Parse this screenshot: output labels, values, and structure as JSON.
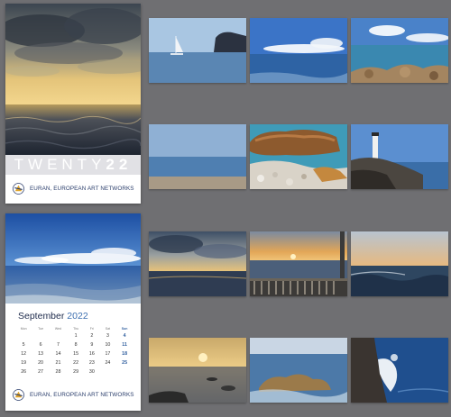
{
  "cover": {
    "title_light": "TWENTY",
    "title_bold": "22",
    "brand_name": "EURAN, EUROPEAN ART NETWORKS"
  },
  "month_page": {
    "month": "September",
    "year": "2022",
    "brand_name": "EURAN, EUROPEAN ART NETWORKS",
    "weekday_headers": [
      "Mon",
      "Tue",
      "Wed",
      "Thu",
      "Fri",
      "Sat",
      "Sun"
    ],
    "weeks": [
      [
        "",
        "",
        "",
        "1",
        "2",
        "3",
        "4"
      ],
      [
        "5",
        "6",
        "7",
        "8",
        "9",
        "10",
        "11"
      ],
      [
        "12",
        "13",
        "14",
        "15",
        "16",
        "17",
        "18"
      ],
      [
        "19",
        "20",
        "21",
        "22",
        "23",
        "24",
        "25"
      ],
      [
        "26",
        "27",
        "28",
        "29",
        "30",
        "",
        ""
      ]
    ]
  },
  "thumbnails": [
    "sailboat-and-cliff",
    "blue-sea-horizon",
    "rocky-shore-clouds",
    "calm-blue-horizon",
    "beach-boulders-pebbles",
    "lighthouse-on-rocks",
    "stormy-sky-sunset",
    "sunset-over-railing",
    "waves-at-dusk",
    "long-exposure-sunset-rocks",
    "rocks-in-blue-sea",
    "wave-crashing-rocks"
  ],
  "colors": {
    "background": "#6f6f72",
    "brand_text": "#2a3d6b",
    "accent_blue": "#3d6fb0"
  }
}
